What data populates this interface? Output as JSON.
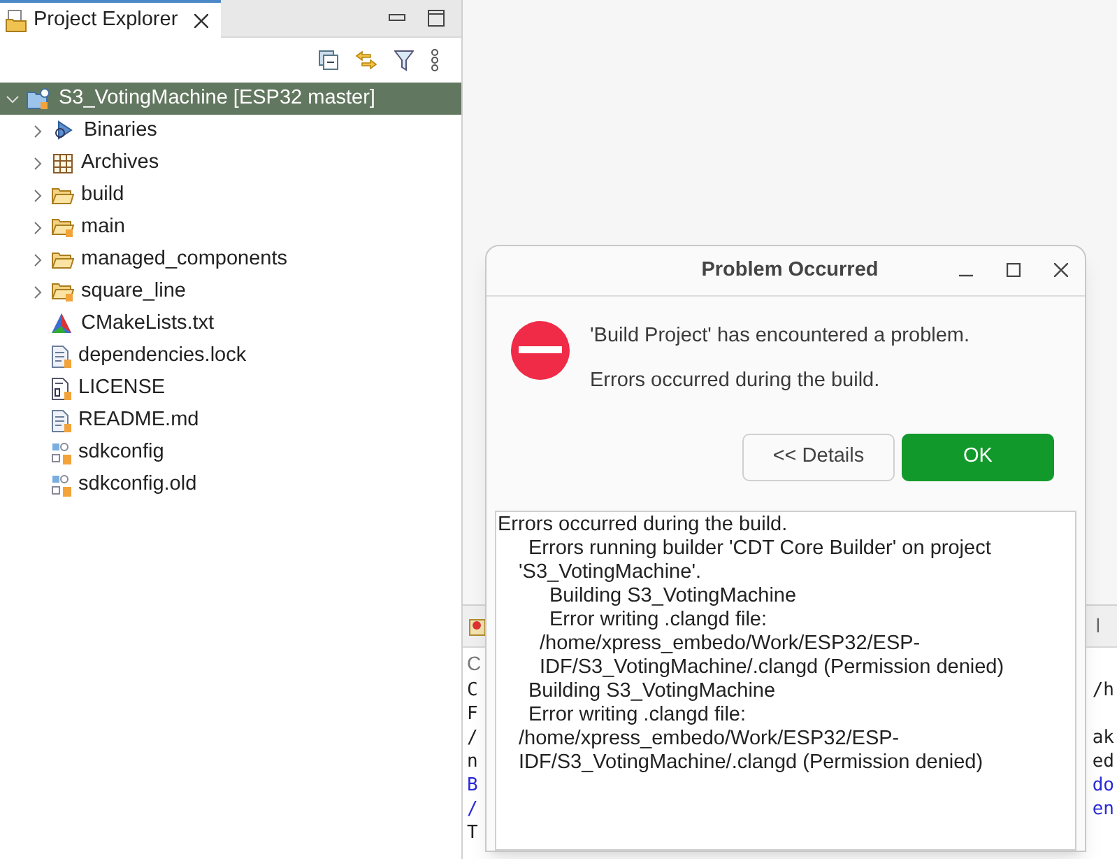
{
  "project_explorer": {
    "tab": {
      "label": "Project Explorer",
      "selected": true
    },
    "tree": [
      {
        "label": "S3_VotingMachine",
        "suffix": "[ESP32 master]",
        "kind": "project",
        "expanded": true,
        "selected": true,
        "children": [
          {
            "label": "Binaries",
            "kind": "binaries",
            "expanded": false,
            "selected": false
          },
          {
            "label": "Archives",
            "kind": "archives",
            "expanded": false,
            "selected": false
          },
          {
            "label": "build",
            "kind": "folder",
            "expanded": false,
            "selected": false
          },
          {
            "label": "main",
            "kind": "folder-shared",
            "expanded": false,
            "selected": false
          },
          {
            "label": "managed_components",
            "kind": "folder",
            "expanded": false,
            "selected": false
          },
          {
            "label": "square_line",
            "kind": "folder-shared",
            "expanded": false,
            "selected": false
          },
          {
            "label": "CMakeLists.txt",
            "kind": "cmake",
            "selected": false
          },
          {
            "label": "dependencies.lock",
            "kind": "file",
            "selected": false
          },
          {
            "label": "LICENSE",
            "kind": "binary-file",
            "selected": false
          },
          {
            "label": "README.md",
            "kind": "file",
            "selected": false
          },
          {
            "label": "sdkconfig",
            "kind": "config",
            "selected": false
          },
          {
            "label": "sdkconfig.old",
            "kind": "config",
            "selected": false
          }
        ]
      }
    ]
  },
  "console": {
    "tab_fragment": "C",
    "tab_end": "l",
    "lines": [
      {
        "left": "C",
        "right": "/h",
        "kind": "plain"
      },
      {
        "left": "F",
        "kind": "plain"
      },
      {
        "left": "/",
        "right": "ak",
        "kind": "plain"
      },
      {
        "left": "n",
        "right": "ed",
        "kind": "plain"
      },
      {
        "left": "B",
        "right": "do",
        "kind": "link"
      },
      {
        "left": "/",
        "right": "en",
        "kind": "link"
      },
      {
        "left": "T",
        "kind": "plain"
      }
    ]
  },
  "dialog": {
    "title": "Problem Occurred",
    "message": "'Build Project' has encountered a problem.",
    "reason": "Errors occurred during the build.",
    "buttons": [
      {
        "label": "<< Details",
        "kind": "secondary"
      },
      {
        "label": "OK",
        "kind": "primary"
      }
    ],
    "details": [
      {
        "text": "Errors occurred during the build.",
        "children": [
          {
            "text": "Errors running builder 'CDT Core Builder' on project 'S3_VotingMachine'.",
            "children": [
              {
                "text": "Building S3_VotingMachine"
              },
              {
                "text": "Error writing .clangd file: /home/xpress_embedo/Work/ESP32/ESP-IDF/S3_VotingMachine/.clangd (Permission denied)"
              }
            ]
          },
          {
            "text": "Building S3_VotingMachine"
          },
          {
            "text": "Error writing .clangd file: /home/xpress_embedo/Work/ESP32/ESP-IDF/S3_VotingMachine/.clangd (Permission denied)"
          }
        ]
      }
    ]
  }
}
